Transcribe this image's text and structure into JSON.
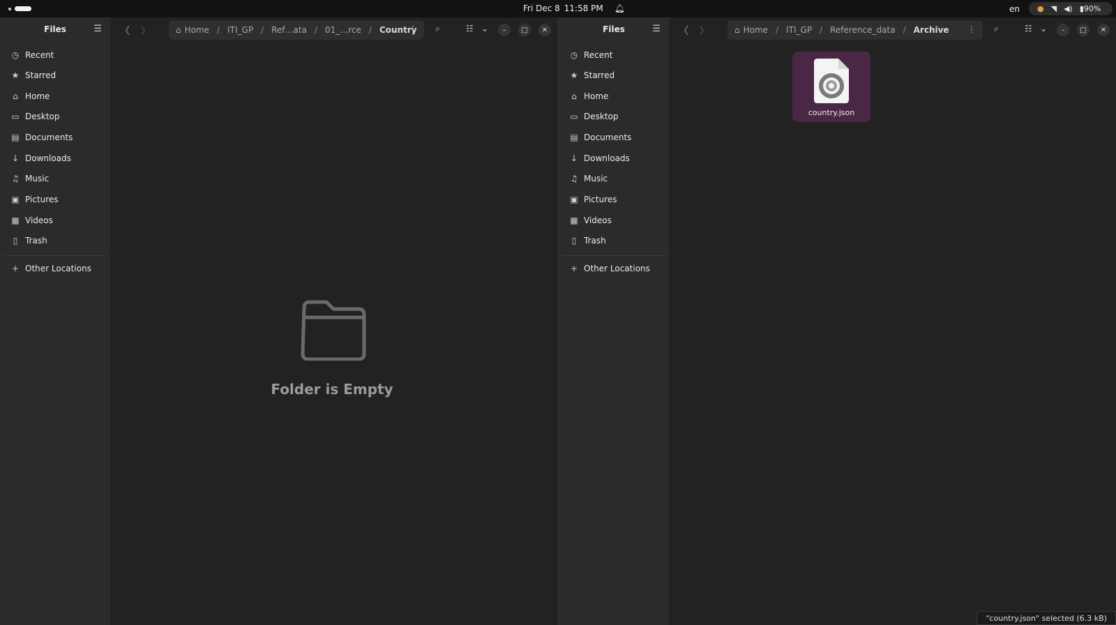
{
  "topbar": {
    "date": "Fri Dec 8",
    "time": "11:58 PM",
    "language": "en",
    "battery": "90%",
    "icons": [
      "notification-bell-icon",
      "microphone-icon",
      "wifi-icon",
      "volume-icon",
      "battery-icon"
    ]
  },
  "left": {
    "sidebar": {
      "title": "Files",
      "items": [
        {
          "label": "Recent",
          "icon": "clock-icon"
        },
        {
          "label": "Starred",
          "icon": "star-icon"
        },
        {
          "label": "Home",
          "icon": "home-icon"
        },
        {
          "label": "Desktop",
          "icon": "desktop-icon"
        },
        {
          "label": "Documents",
          "icon": "document-icon"
        },
        {
          "label": "Downloads",
          "icon": "download-icon"
        },
        {
          "label": "Music",
          "icon": "music-icon"
        },
        {
          "label": "Pictures",
          "icon": "picture-icon"
        },
        {
          "label": "Videos",
          "icon": "video-icon"
        },
        {
          "label": "Trash",
          "icon": "trash-icon"
        }
      ],
      "other_locations": "Other Locations"
    },
    "path": [
      "Home",
      "ITI_GP",
      "Ref…ata",
      "01_…rce",
      "Country"
    ],
    "empty_message": "Folder is Empty"
  },
  "right": {
    "sidebar": {
      "title": "Files",
      "items": [
        {
          "label": "Recent",
          "icon": "clock-icon"
        },
        {
          "label": "Starred",
          "icon": "star-icon"
        },
        {
          "label": "Home",
          "icon": "home-icon"
        },
        {
          "label": "Desktop",
          "icon": "desktop-icon"
        },
        {
          "label": "Documents",
          "icon": "document-icon"
        },
        {
          "label": "Downloads",
          "icon": "download-icon"
        },
        {
          "label": "Music",
          "icon": "music-icon"
        },
        {
          "label": "Pictures",
          "icon": "picture-icon"
        },
        {
          "label": "Videos",
          "icon": "video-icon"
        },
        {
          "label": "Trash",
          "icon": "trash-icon"
        }
      ],
      "other_locations": "Other Locations"
    },
    "path": [
      "Home",
      "ITI_GP",
      "Reference_data",
      "Archive"
    ],
    "file": {
      "name": "country.json",
      "icon": "json-file-icon",
      "selected": true
    },
    "status": "\"country.json\" selected  (6.3 kB)"
  },
  "colors": {
    "selection": "#4a2745",
    "accent_mic": "#e6a23c"
  }
}
